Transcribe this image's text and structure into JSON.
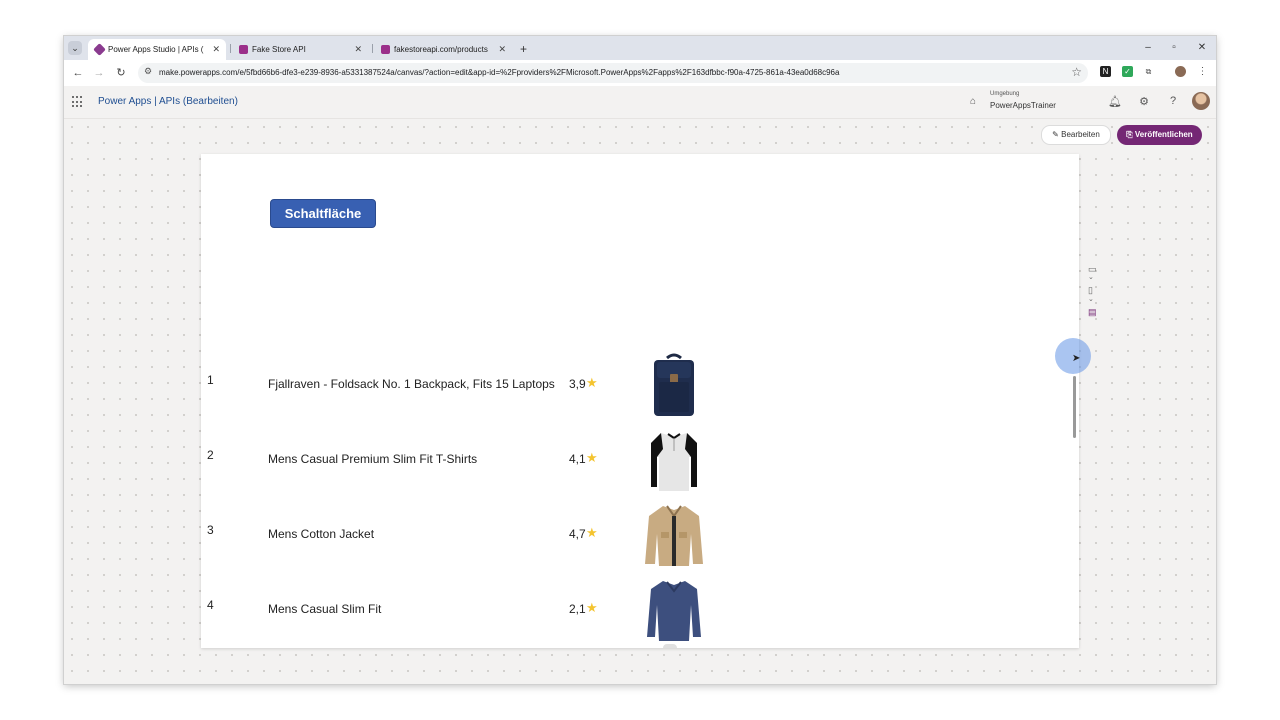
{
  "browser": {
    "tabs": [
      {
        "title": "Power Apps Studio | APIs (Bea",
        "close": "✕",
        "fav_color": "#8a3b8f"
      },
      {
        "title": "Fake Store API",
        "close": "✕",
        "fav_color": "#9b2f8a"
      },
      {
        "title": "fakestoreapi.com/products",
        "close": "✕",
        "fav_color": "#9b2f8a"
      }
    ],
    "new_tab": "+",
    "url": "make.powerapps.com/e/5fbd66b6-dfe3-e239-8936-a5331387524a/canvas/?action=edit&app-id=%2Fproviders%2FMicrosoft.PowerApps%2Fapps%2F163dfbbc-f90a-4725-861a-43ea0d68c96a"
  },
  "appbar": {
    "title": "Power Apps  |  APIs (Bearbeiten)",
    "environment_label": "Umgebung",
    "environment_name": "PowerAppsTrainer"
  },
  "actions": {
    "edit_label": "Bearbeiten",
    "publish_label": "Veröffentlichen"
  },
  "screen": {
    "button_label": "Schaltfläche",
    "products": [
      {
        "index": "1",
        "title": "Fjallraven - Foldsack No. 1 Backpack, Fits 15 Laptops",
        "rating": "3,9",
        "image": "backpack"
      },
      {
        "index": "2",
        "title": "Mens Casual Premium Slim Fit T-Shirts",
        "rating": "4,1",
        "image": "raglan-shirt"
      },
      {
        "index": "3",
        "title": "Mens Cotton Jacket",
        "rating": "4,7",
        "image": "jacket"
      },
      {
        "index": "4",
        "title": "Mens Casual Slim Fit",
        "rating": "2,1",
        "image": "longsleeve"
      }
    ]
  },
  "colors": {
    "accent": "#742774",
    "button": "#3860b2",
    "star": "#f4c430"
  }
}
